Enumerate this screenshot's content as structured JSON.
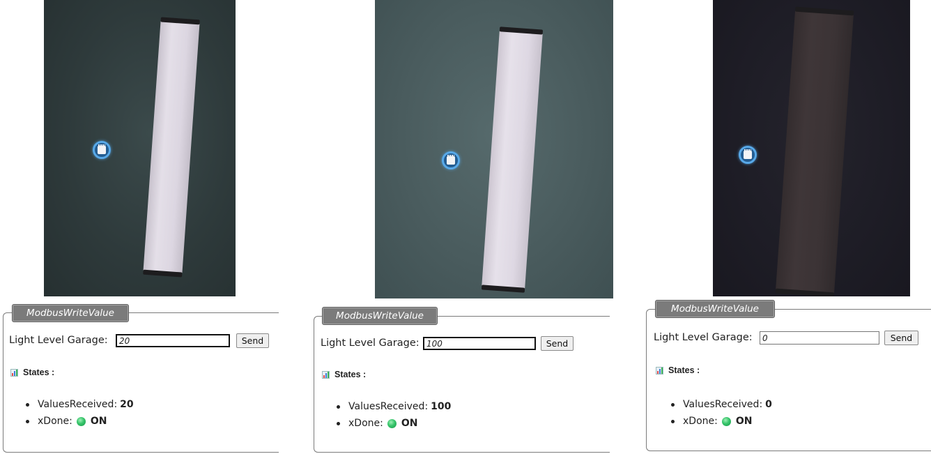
{
  "panels": [
    {
      "legend": "ModbusWriteValue",
      "label": "Light Level Garage:",
      "input_value": "20",
      "input_focused": true,
      "send_label": "Send",
      "states_title": "States :",
      "states": [
        {
          "name": "ValuesReceived",
          "separator": " :",
          "value": "20",
          "indicator": false
        },
        {
          "name": "xDone",
          "separator": " :",
          "value": "ON",
          "indicator": true,
          "indicator_color": "#36c46a"
        }
      ],
      "scene_bg": "#2f3c3d",
      "lamp_state": "lit"
    },
    {
      "legend": "ModbusWriteValue",
      "label": "Light Level Garage:",
      "input_value": "100",
      "input_focused": true,
      "send_label": "Send",
      "states_title": "States :",
      "states": [
        {
          "name": "ValuesReceived",
          "separator": " :",
          "value": "100",
          "indicator": false
        },
        {
          "name": "xDone",
          "separator": " :",
          "value": "ON",
          "indicator": true,
          "indicator_color": "#36c46a"
        }
      ],
      "scene_bg": "#47595b",
      "lamp_state": "lit"
    },
    {
      "legend": "ModbusWriteValue",
      "label": "Light Level Garage:",
      "input_value": "0",
      "input_focused": false,
      "send_label": "Send",
      "states_title": "States :",
      "states": [
        {
          "name": "ValuesReceived",
          "separator": " :",
          "value": "0",
          "indicator": false
        },
        {
          "name": "xDone",
          "separator": " :",
          "value": "ON",
          "indicator": true,
          "indicator_color": "#36c46a"
        }
      ],
      "scene_bg": "#1d1c25",
      "lamp_state": "off"
    }
  ],
  "colors": {
    "legend_bg": "#7b7b7b",
    "sensor_ring": "#58a9e9",
    "lamp_lit": "#d9d3df",
    "lamp_off": "#3a3234"
  }
}
